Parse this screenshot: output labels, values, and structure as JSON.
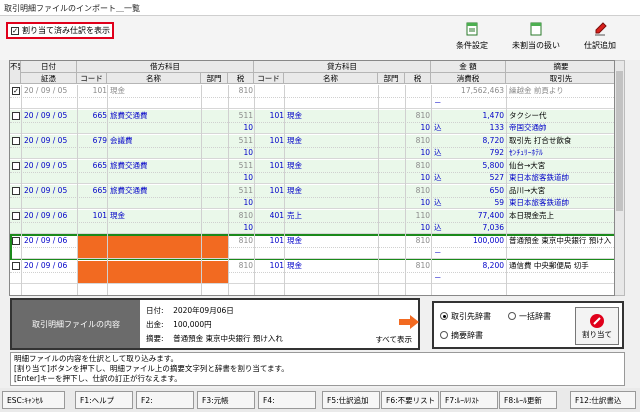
{
  "window": {
    "title": "取引明細ファイルのインポート＿一覧"
  },
  "toolbar": {
    "show_assigned_label": "割り当て済み仕訳を表示",
    "condition_label": "条件設定",
    "unassigned_label": "未割当の扱い",
    "add_entry_label": "仕訳追加"
  },
  "grid": {
    "headers": {
      "unneeded": "不要",
      "date": "日付",
      "voucher": "証憑",
      "debit": "借方科目",
      "credit": "貸方科目",
      "amount": "金 額",
      "tax_amount": "消費税",
      "summary": "摘要",
      "partner": "取引先",
      "code": "コード",
      "name": "名称",
      "dept": "部門",
      "tax": "税"
    },
    "rows": [
      {
        "style": "white",
        "checked": true,
        "grayed": true,
        "date": "20 / 09 / 05",
        "voucher": "101",
        "dcode": "101",
        "dname": "現金",
        "dtax": "810",
        "amount": "17,562,463",
        "summary": "繰越金 前頁より",
        "sub_mark": "－",
        "sub_amount": "",
        "sub_text": ""
      },
      {
        "style": "green",
        "date": "20 / 09 / 05",
        "voucher": "665",
        "dcode": "665",
        "dname": "旅費交通費",
        "dtax": "511",
        "ccode": "101",
        "cname": "現金",
        "ctax": "810",
        "amount": "1,470",
        "summary": "タクシー代",
        "sub_tax": "10",
        "sub_mark": "込",
        "sub_amount": "133",
        "sub_text": "帝国交通帥"
      },
      {
        "style": "green",
        "date": "20 / 09 / 05",
        "voucher": "679",
        "dcode": "679",
        "dname": "会議費",
        "dtax": "511",
        "ccode": "101",
        "cname": "現金",
        "ctax": "810",
        "amount": "8,720",
        "summary": "取引先 打合せ飲食",
        "sub_tax": "10",
        "sub_mark": "込",
        "sub_amount": "792",
        "sub_text": "ｾﾝﾁｭﾘｰﾎﾃﾙ"
      },
      {
        "style": "green",
        "date": "20 / 09 / 05",
        "voucher": "665",
        "dcode": "665",
        "dname": "旅費交通費",
        "dtax": "511",
        "ccode": "101",
        "cname": "現金",
        "ctax": "810",
        "amount": "5,800",
        "summary": "仙台→大宮",
        "sub_tax": "10",
        "sub_mark": "込",
        "sub_amount": "527",
        "sub_text": "東日本旅客鉄道帥"
      },
      {
        "style": "green",
        "date": "20 / 09 / 05",
        "voucher": "665",
        "dcode": "665",
        "dname": "旅費交通費",
        "dtax": "511",
        "ccode": "101",
        "cname": "現金",
        "ctax": "810",
        "amount": "650",
        "summary": "品川→大宮",
        "sub_tax": "10",
        "sub_mark": "込",
        "sub_amount": "59",
        "sub_text": "東日本旅客鉄道帥"
      },
      {
        "style": "green",
        "date": "20 / 09 / 06",
        "voucher": "101",
        "dcode": "101",
        "dname": "現金",
        "dtax": "810",
        "ccode": "401",
        "cname": "売上",
        "ctax": "110",
        "amount": "77,400",
        "summary": "本日現金売上",
        "sub_tax": "10",
        "sub_mark": "込",
        "sub_amount": "7,036",
        "sub_text": ""
      },
      {
        "style": "white",
        "selected": true,
        "orange": true,
        "date": "20 / 09 / 06",
        "voucher": "",
        "dcode": "",
        "dname": "",
        "dtax": "810",
        "ccode": "101",
        "cname": "現金",
        "ctax": "810",
        "amount": "100,000",
        "summary": "普通預金 東京中央銀行 預け入",
        "sub_mark": "－",
        "sub_amount": "",
        "sub_text": ""
      },
      {
        "style": "white",
        "orange": true,
        "date": "20 / 09 / 06",
        "voucher": "",
        "dcode": "",
        "dname": "",
        "dtax": "810",
        "ccode": "101",
        "cname": "現金",
        "ctax": "810",
        "amount": "8,200",
        "summary": "通信費 中央郵便局 切手",
        "sub_mark": "－",
        "sub_amount": "",
        "sub_text": ""
      }
    ]
  },
  "detail": {
    "title": "取引明細ファイルの内容",
    "date_label": "日付:",
    "date_value": "2020年09月06日",
    "out_label": "出金:",
    "out_value": "100,000円",
    "summary_label": "摘要:",
    "summary_value": "普通預金 東京中央銀行 預け入れ",
    "show_all": "すべて表示"
  },
  "dict": {
    "partner": "取引先辞書",
    "batch": "一括辞書",
    "summary": "摘要辞書",
    "assign": "割り当て"
  },
  "messages": [
    "明細ファイルの内容を仕訳として取り込みます。",
    "[割り当て]ボタンを押下し、明細ファイル上の摘要文字列と辞書を割り当てます。",
    "[Enter]キーを押下し、仕訳の訂正が行なえます。"
  ],
  "fkeys": [
    "ESC:ｷｬﾝｾﾙ",
    "F1:ヘルプ",
    "F2:",
    "F3:元帳",
    "F4:",
    "F5:仕訳追加",
    "F6:不要リスト",
    "F7:ﾙｰﾙﾘｽﾄ",
    "F8:ﾙｰﾙ更新",
    "F12:仕訳書込"
  ],
  "colors": {
    "accent_red": "#e0001b",
    "row_green": "#eaf8ea",
    "orange": "#f26a21",
    "select_green": "#1b8a1b",
    "link_blue": "#0000c8"
  }
}
